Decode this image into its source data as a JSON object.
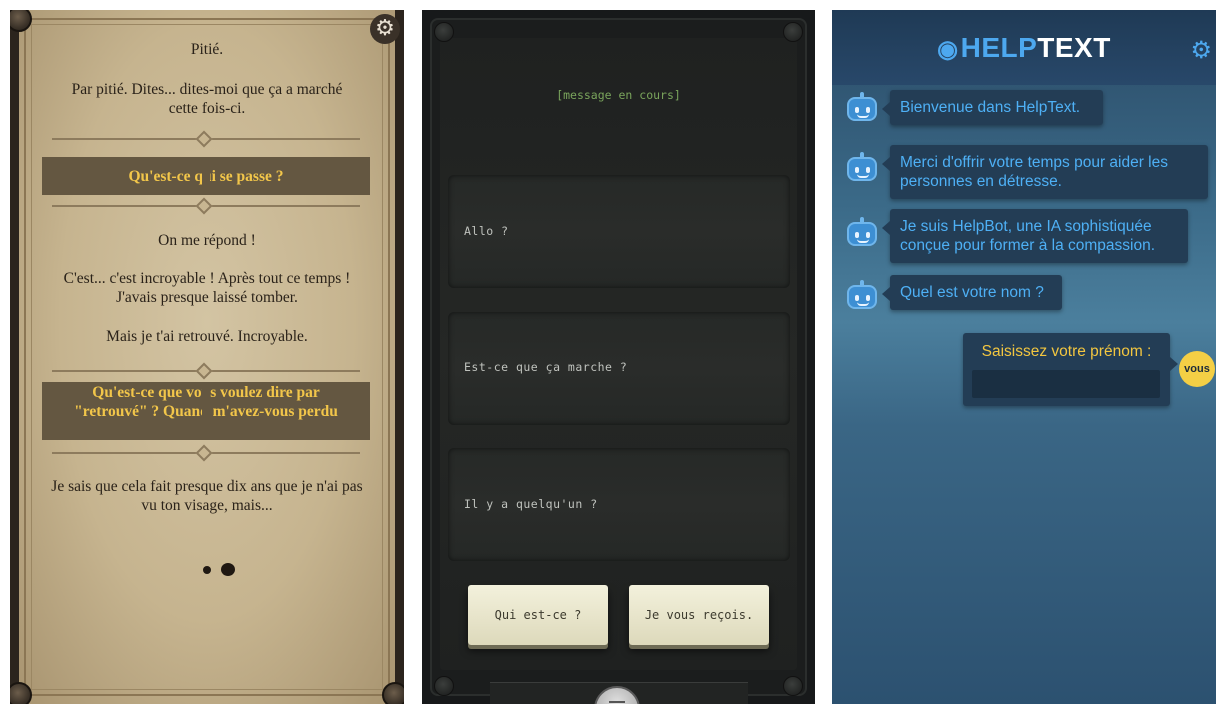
{
  "panel1": {
    "settings_icon": "gear-icon",
    "lines": [
      "Pitié.",
      "Par pitié. Dites... dites-moi que ça a marché cette fois-ci.",
      "On me répond !",
      "C'est... c'est incroyable ! Après tout ce temps ! J'avais presque laissé tomber.",
      "Mais je t'ai retrouvé. Incroyable.",
      "Je sais que cela fait presque dix ans que je n'ai pas vu ton visage, mais..."
    ],
    "choices": [
      "Qu'est-ce qui se passe ?",
      "Qu'est-ce que vous voulez dire par \"retrouvé\" ? Quand m'avez-vous perdu ?"
    ]
  },
  "panel2": {
    "status": "[message en cours]",
    "messages": [
      "Allo ?",
      "Est-ce que ça marche ?",
      "Il y a quelqu'un ?"
    ],
    "buttons": [
      "Qui est-ce ?",
      "Je vous reçois."
    ],
    "menu_icon": "menu-handle-icon"
  },
  "panel3": {
    "title_help": "HELP",
    "title_text": "TEXT",
    "logo_icon": "helptext-logo-icon",
    "settings_icon": "gear-icon",
    "messages": [
      "Bienvenue dans HelpText.",
      "Merci d'offrir votre temps pour aider les personnes en détresse.",
      "Je suis HelpBot, une IA sophistiquée conçue pour former à la compassion.",
      "Quel est votre nom ?"
    ],
    "bot_icon": "robot-avatar-icon",
    "prompt_label": "Saisissez votre prénom :",
    "name_input_value": "",
    "user_badge": "vous",
    "colors": {
      "accent": "#4da8ef",
      "highlight": "#f2c640",
      "bubble": "#233d55"
    }
  }
}
